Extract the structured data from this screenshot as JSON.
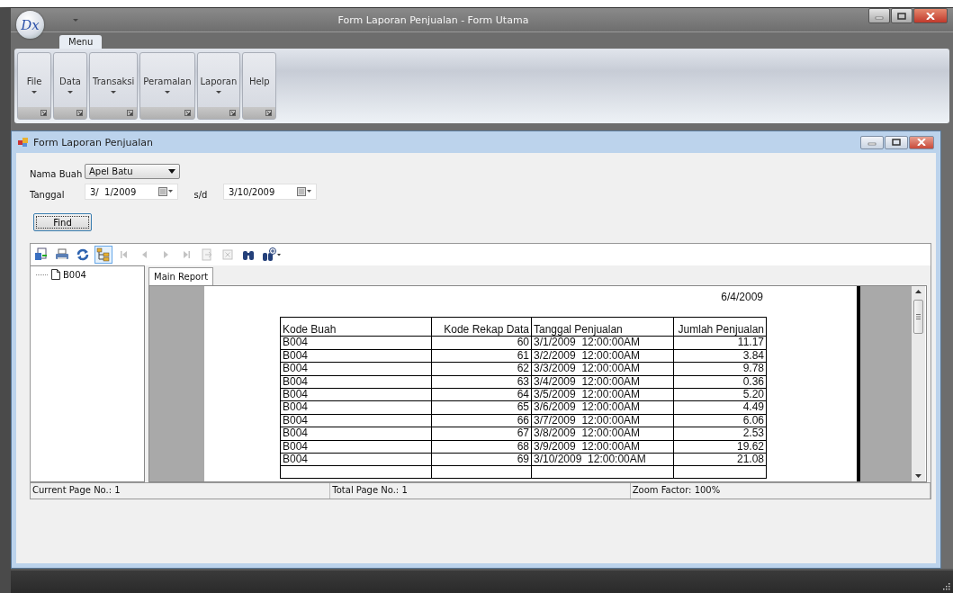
{
  "window": {
    "title": "Form Laporan Penjualan - Form Utama",
    "app_logo": "Dx"
  },
  "ribbon": {
    "tabs": [
      {
        "label": "Menu",
        "selected": true
      }
    ],
    "groups": [
      {
        "label": "File",
        "dropdown": true
      },
      {
        "label": "Data",
        "dropdown": true
      },
      {
        "label": "Transaksi",
        "dropdown": true
      },
      {
        "label": "Peramalan",
        "dropdown": true
      },
      {
        "label": "Laporan",
        "dropdown": true
      },
      {
        "label": "Help",
        "dropdown": false
      }
    ]
  },
  "child_window": {
    "title": "Form Laporan Penjualan"
  },
  "form": {
    "nama_buah": {
      "label": "Nama Buah",
      "value": "Apel Batu"
    },
    "tanggal": {
      "label": "Tanggal",
      "from": "3/  1/2009",
      "separator": "s/d",
      "to": "3/10/2009"
    },
    "find_button": "Find"
  },
  "viewer": {
    "toolbar": [
      {
        "kind": "export",
        "disabled": false,
        "on": false
      },
      {
        "kind": "print",
        "disabled": false,
        "on": false
      },
      {
        "kind": "refresh",
        "disabled": false,
        "on": false
      },
      {
        "kind": "tree",
        "disabled": false,
        "on": true
      },
      {
        "kind": "first",
        "disabled": true,
        "on": false
      },
      {
        "kind": "prev",
        "disabled": true,
        "on": false
      },
      {
        "kind": "next",
        "disabled": true,
        "on": false
      },
      {
        "kind": "last",
        "disabled": true,
        "on": false
      },
      {
        "kind": "goto",
        "disabled": true,
        "on": false
      },
      {
        "kind": "stop",
        "disabled": true,
        "on": false
      },
      {
        "kind": "search",
        "disabled": false,
        "on": false
      },
      {
        "kind": "zoom",
        "disabled": false,
        "on": false
      }
    ],
    "tree": [
      {
        "label": "B004"
      }
    ],
    "report_tabs": [
      {
        "label": "Main Report",
        "selected": true
      }
    ],
    "report": {
      "date": "6/4/2009",
      "columns": [
        {
          "label": "Kode Buah",
          "kind": "text"
        },
        {
          "label": "Kode Rekap Data",
          "kind": "number"
        },
        {
          "label": "Tanggal Penjualan",
          "kind": "text"
        },
        {
          "label": "Jumlah Penjualan",
          "kind": "number"
        }
      ],
      "rows": [
        [
          "B004",
          "60",
          "3/1/2009  12:00:00AM",
          "11.17"
        ],
        [
          "B004",
          "61",
          "3/2/2009  12:00:00AM",
          "3.84"
        ],
        [
          "B004",
          "62",
          "3/3/2009  12:00:00AM",
          "9.78"
        ],
        [
          "B004",
          "63",
          "3/4/2009  12:00:00AM",
          "0.36"
        ],
        [
          "B004",
          "64",
          "3/5/2009  12:00:00AM",
          "5.20"
        ],
        [
          "B004",
          "65",
          "3/6/2009  12:00:00AM",
          "4.49"
        ],
        [
          "B004",
          "66",
          "3/7/2009  12:00:00AM",
          "6.06"
        ],
        [
          "B004",
          "67",
          "3/8/2009  12:00:00AM",
          "2.53"
        ],
        [
          "B004",
          "68",
          "3/9/2009  12:00:00AM",
          "19.62"
        ],
        [
          "B004",
          "69",
          "3/10/2009  12:00:00AM",
          "21.08"
        ]
      ]
    },
    "status": [
      "Current Page No.: 1",
      "Total Page No.: 1",
      "Zoom Factor: 100%"
    ]
  }
}
